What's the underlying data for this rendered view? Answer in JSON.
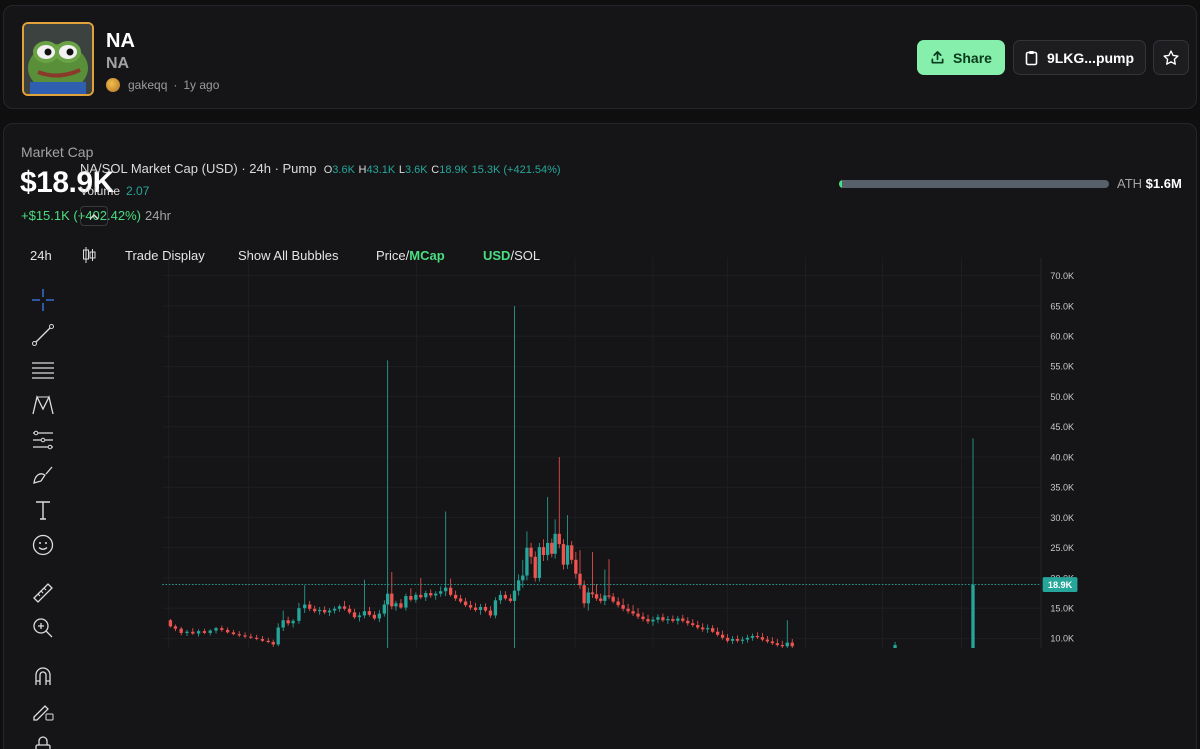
{
  "token": {
    "name": "NA",
    "symbol": "NA",
    "creator": "gakeqq",
    "age": "1y ago"
  },
  "actions": {
    "share_label": "Share",
    "contract_label": "9LKG...pump"
  },
  "market": {
    "label": "Market Cap",
    "value": "$18.9K",
    "change": "+$15.1K (+402.42%)",
    "period": "24hr",
    "ath_label": "ATH",
    "ath_value": "$1.6M",
    "ath_progress": 0.012
  },
  "toolbar": {
    "interval": "24h",
    "trade_display": "Trade Display",
    "show_bubbles": "Show All Bubbles",
    "price_label": "Price",
    "mcap_label": "MCap",
    "usd_label": "USD",
    "sol_label": "SOL"
  },
  "legend": {
    "title": "NA/SOL Market Cap (USD) · 24h · Pump",
    "o_key": "O",
    "o_val": "3.6K",
    "h_key": "H",
    "h_val": "43.1K",
    "l_key": "L",
    "l_val": "3.6K",
    "c_key": "C",
    "c_val": "18.9K",
    "change": "15.3K (+421.54%)",
    "volume_label": "Volume",
    "volume_value": "2.07"
  },
  "colors": {
    "up": "#26a69a",
    "down": "#ef5350",
    "accent": "#86efac"
  },
  "chart_data": {
    "type": "candlestick",
    "ylim": [
      8200,
      72000
    ],
    "yticks": [
      10000,
      15000,
      20000,
      25000,
      30000,
      35000,
      40000,
      45000,
      50000,
      55000,
      60000,
      65000,
      70000
    ],
    "ytick_labels": [
      "10.0K",
      "15.0K",
      "20.0K",
      "25.0K",
      "30.0K",
      "35.0K",
      "40.0K",
      "45.0K",
      "50.0K",
      "55.0K",
      "60.0K",
      "65.0K",
      "70.0K"
    ],
    "current_value": 18900,
    "current_label": "18.9K",
    "candles": [
      {
        "x": 76,
        "o": 13000,
        "h": 13200,
        "l": 11800,
        "c": 12000
      },
      {
        "x": 82,
        "o": 12000,
        "h": 12300,
        "l": 11200,
        "c": 11600
      },
      {
        "x": 89,
        "o": 11600,
        "h": 11900,
        "l": 10500,
        "c": 10900
      },
      {
        "x": 96,
        "o": 10900,
        "h": 11400,
        "l": 10400,
        "c": 11100
      },
      {
        "x": 103,
        "o": 11100,
        "h": 11700,
        "l": 10600,
        "c": 10800
      },
      {
        "x": 110,
        "o": 10800,
        "h": 11500,
        "l": 10300,
        "c": 11200
      },
      {
        "x": 117,
        "o": 11200,
        "h": 11600,
        "l": 10700,
        "c": 10900
      },
      {
        "x": 124,
        "o": 10900,
        "h": 11500,
        "l": 10500,
        "c": 11300
      },
      {
        "x": 131,
        "o": 11300,
        "h": 11900,
        "l": 10800,
        "c": 11700
      },
      {
        "x": 138,
        "o": 11700,
        "h": 12100,
        "l": 11100,
        "c": 11400
      },
      {
        "x": 145,
        "o": 11400,
        "h": 11800,
        "l": 10800,
        "c": 11000
      },
      {
        "x": 152,
        "o": 11000,
        "h": 11400,
        "l": 10500,
        "c": 10700
      },
      {
        "x": 159,
        "o": 10700,
        "h": 11200,
        "l": 10200,
        "c": 10500
      },
      {
        "x": 166,
        "o": 10500,
        "h": 11000,
        "l": 10000,
        "c": 10300
      },
      {
        "x": 173,
        "o": 10300,
        "h": 10800,
        "l": 9900,
        "c": 10100
      },
      {
        "x": 180,
        "o": 10100,
        "h": 10600,
        "l": 9700,
        "c": 9900
      },
      {
        "x": 187,
        "o": 9900,
        "h": 10400,
        "l": 9400,
        "c": 9600
      },
      {
        "x": 194,
        "o": 9600,
        "h": 10100,
        "l": 9200,
        "c": 9400
      },
      {
        "x": 200,
        "o": 9400,
        "h": 9800,
        "l": 8600,
        "c": 9000
      },
      {
        "x": 206,
        "o": 9000,
        "h": 12500,
        "l": 8700,
        "c": 11800
      },
      {
        "x": 212,
        "o": 11800,
        "h": 14600,
        "l": 11200,
        "c": 13000
      },
      {
        "x": 218,
        "o": 13000,
        "h": 13600,
        "l": 12100,
        "c": 12500
      },
      {
        "x": 224,
        "o": 12500,
        "h": 13200,
        "l": 11800,
        "c": 12900
      },
      {
        "x": 231,
        "o": 12900,
        "h": 15900,
        "l": 12400,
        "c": 15000
      },
      {
        "x": 238,
        "o": 15000,
        "h": 18800,
        "l": 14200,
        "c": 15600
      },
      {
        "x": 244,
        "o": 15600,
        "h": 16200,
        "l": 14500,
        "c": 14900
      },
      {
        "x": 250,
        "o": 14900,
        "h": 15400,
        "l": 14200,
        "c": 14500
      },
      {
        "x": 256,
        "o": 14500,
        "h": 15200,
        "l": 13900,
        "c": 14700
      },
      {
        "x": 262,
        "o": 14700,
        "h": 15300,
        "l": 14000,
        "c": 14300
      },
      {
        "x": 268,
        "o": 14300,
        "h": 15000,
        "l": 13700,
        "c": 14600
      },
      {
        "x": 274,
        "o": 14600,
        "h": 15300,
        "l": 14100,
        "c": 14900
      },
      {
        "x": 280,
        "o": 14900,
        "h": 15600,
        "l": 14400,
        "c": 15300
      },
      {
        "x": 286,
        "o": 15300,
        "h": 16200,
        "l": 14600,
        "c": 14900
      },
      {
        "x": 292,
        "o": 14900,
        "h": 15500,
        "l": 14000,
        "c": 14300
      },
      {
        "x": 298,
        "o": 14300,
        "h": 14900,
        "l": 13200,
        "c": 13500
      },
      {
        "x": 304,
        "o": 13500,
        "h": 14300,
        "l": 12800,
        "c": 13800
      },
      {
        "x": 310,
        "o": 13800,
        "h": 19700,
        "l": 13300,
        "c": 14500
      },
      {
        "x": 316,
        "o": 14500,
        "h": 15200,
        "l": 13600,
        "c": 13900
      },
      {
        "x": 322,
        "o": 13900,
        "h": 14500,
        "l": 13000,
        "c": 13300
      },
      {
        "x": 328,
        "o": 13300,
        "h": 14700,
        "l": 12700,
        "c": 14100
      },
      {
        "x": 334,
        "o": 14100,
        "h": 16300,
        "l": 13600,
        "c": 15600
      },
      {
        "x": 338,
        "o": 15600,
        "h": 56000,
        "l": 8200,
        "c": 17400
      },
      {
        "x": 343,
        "o": 17400,
        "h": 21000,
        "l": 14800,
        "c": 15300
      },
      {
        "x": 348,
        "o": 15300,
        "h": 16200,
        "l": 14600,
        "c": 15800
      },
      {
        "x": 354,
        "o": 15800,
        "h": 16500,
        "l": 14900,
        "c": 15100
      },
      {
        "x": 360,
        "o": 15100,
        "h": 17400,
        "l": 14600,
        "c": 17000
      },
      {
        "x": 366,
        "o": 17000,
        "h": 18300,
        "l": 16100,
        "c": 16400
      },
      {
        "x": 372,
        "o": 16400,
        "h": 17600,
        "l": 15900,
        "c": 17200
      },
      {
        "x": 378,
        "o": 17200,
        "h": 20000,
        "l": 16500,
        "c": 16800
      },
      {
        "x": 384,
        "o": 16800,
        "h": 17900,
        "l": 16200,
        "c": 17500
      },
      {
        "x": 390,
        "o": 17500,
        "h": 18100,
        "l": 16700,
        "c": 17100
      },
      {
        "x": 396,
        "o": 17100,
        "h": 17800,
        "l": 16400,
        "c": 17400
      },
      {
        "x": 402,
        "o": 17400,
        "h": 18600,
        "l": 16900,
        "c": 17800
      },
      {
        "x": 408,
        "o": 17800,
        "h": 31000,
        "l": 17000,
        "c": 18400
      },
      {
        "x": 414,
        "o": 18400,
        "h": 19900,
        "l": 16900,
        "c": 17200
      },
      {
        "x": 420,
        "o": 17200,
        "h": 17900,
        "l": 16200,
        "c": 16600
      },
      {
        "x": 426,
        "o": 16600,
        "h": 17200,
        "l": 15800,
        "c": 16100
      },
      {
        "x": 432,
        "o": 16100,
        "h": 16700,
        "l": 15200,
        "c": 15500
      },
      {
        "x": 438,
        "o": 15500,
        "h": 16200,
        "l": 14700,
        "c": 15100
      },
      {
        "x": 444,
        "o": 15100,
        "h": 15900,
        "l": 14400,
        "c": 14700
      },
      {
        "x": 450,
        "o": 14700,
        "h": 15700,
        "l": 13900,
        "c": 15200
      },
      {
        "x": 456,
        "o": 15200,
        "h": 15800,
        "l": 14300,
        "c": 14600
      },
      {
        "x": 462,
        "o": 14600,
        "h": 15300,
        "l": 13400,
        "c": 13800
      },
      {
        "x": 468,
        "o": 13800,
        "h": 16800,
        "l": 13300,
        "c": 16300
      },
      {
        "x": 474,
        "o": 16300,
        "h": 17900,
        "l": 15700,
        "c": 17200
      },
      {
        "x": 480,
        "o": 17200,
        "h": 17800,
        "l": 16300,
        "c": 16600
      },
      {
        "x": 486,
        "o": 16600,
        "h": 17300,
        "l": 15900,
        "c": 16200
      },
      {
        "x": 491,
        "o": 16200,
        "h": 65000,
        "l": 8200,
        "c": 17900
      },
      {
        "x": 496,
        "o": 17900,
        "h": 20600,
        "l": 17100,
        "c": 19600
      },
      {
        "x": 501,
        "o": 19600,
        "h": 23000,
        "l": 18400,
        "c": 20400
      },
      {
        "x": 506,
        "o": 20400,
        "h": 27700,
        "l": 19600,
        "c": 25000
      },
      {
        "x": 511,
        "o": 25000,
        "h": 25800,
        "l": 22300,
        "c": 23500
      },
      {
        "x": 516,
        "o": 23500,
        "h": 24400,
        "l": 19400,
        "c": 20000
      },
      {
        "x": 521,
        "o": 20000,
        "h": 25800,
        "l": 19400,
        "c": 25100
      },
      {
        "x": 526,
        "o": 25100,
        "h": 26400,
        "l": 22800,
        "c": 23800
      },
      {
        "x": 531,
        "o": 23800,
        "h": 33400,
        "l": 22900,
        "c": 25800
      },
      {
        "x": 536,
        "o": 25800,
        "h": 26500,
        "l": 23400,
        "c": 24000
      },
      {
        "x": 540,
        "o": 24000,
        "h": 29700,
        "l": 23200,
        "c": 27300
      },
      {
        "x": 545,
        "o": 27300,
        "h": 40000,
        "l": 24900,
        "c": 25600
      },
      {
        "x": 550,
        "o": 25600,
        "h": 26400,
        "l": 21400,
        "c": 22200
      },
      {
        "x": 555,
        "o": 22200,
        "h": 30400,
        "l": 21500,
        "c": 25400
      },
      {
        "x": 560,
        "o": 25400,
        "h": 26100,
        "l": 22300,
        "c": 23000
      },
      {
        "x": 565,
        "o": 23000,
        "h": 24300,
        "l": 19900,
        "c": 20700
      },
      {
        "x": 570,
        "o": 20700,
        "h": 24600,
        "l": 18200,
        "c": 18800
      },
      {
        "x": 575,
        "o": 18800,
        "h": 19600,
        "l": 15100,
        "c": 15800
      },
      {
        "x": 580,
        "o": 15800,
        "h": 18400,
        "l": 14600,
        "c": 17600
      },
      {
        "x": 585,
        "o": 17600,
        "h": 24300,
        "l": 16700,
        "c": 17300
      },
      {
        "x": 590,
        "o": 17300,
        "h": 19000,
        "l": 16200,
        "c": 16600
      },
      {
        "x": 595,
        "o": 16600,
        "h": 17400,
        "l": 15800,
        "c": 16200
      },
      {
        "x": 600,
        "o": 16200,
        "h": 21400,
        "l": 15500,
        "c": 17100
      },
      {
        "x": 605,
        "o": 17100,
        "h": 23100,
        "l": 16500,
        "c": 16900
      },
      {
        "x": 610,
        "o": 16900,
        "h": 17500,
        "l": 15800,
        "c": 16100
      },
      {
        "x": 616,
        "o": 16100,
        "h": 16800,
        "l": 15100,
        "c": 15500
      },
      {
        "x": 622,
        "o": 15500,
        "h": 16600,
        "l": 14500,
        "c": 14900
      },
      {
        "x": 628,
        "o": 14900,
        "h": 15700,
        "l": 14100,
        "c": 14500
      },
      {
        "x": 634,
        "o": 14500,
        "h": 15500,
        "l": 13700,
        "c": 14100
      },
      {
        "x": 640,
        "o": 14100,
        "h": 15000,
        "l": 13200,
        "c": 13600
      },
      {
        "x": 646,
        "o": 13600,
        "h": 14300,
        "l": 12800,
        "c": 13200
      },
      {
        "x": 652,
        "o": 13200,
        "h": 13900,
        "l": 12400,
        "c": 12800
      },
      {
        "x": 658,
        "o": 12800,
        "h": 13600,
        "l": 12100,
        "c": 13100
      },
      {
        "x": 664,
        "o": 13100,
        "h": 14000,
        "l": 12500,
        "c": 13500
      },
      {
        "x": 670,
        "o": 13500,
        "h": 14100,
        "l": 12700,
        "c": 13000
      },
      {
        "x": 676,
        "o": 13000,
        "h": 13700,
        "l": 12400,
        "c": 13200
      },
      {
        "x": 682,
        "o": 13200,
        "h": 13800,
        "l": 12600,
        "c": 12900
      },
      {
        "x": 688,
        "o": 12900,
        "h": 13700,
        "l": 12300,
        "c": 13300
      },
      {
        "x": 694,
        "o": 13300,
        "h": 13900,
        "l": 12600,
        "c": 12900
      },
      {
        "x": 700,
        "o": 12900,
        "h": 13500,
        "l": 12100,
        "c": 12500
      },
      {
        "x": 706,
        "o": 12500,
        "h": 13200,
        "l": 11900,
        "c": 12200
      },
      {
        "x": 712,
        "o": 12200,
        "h": 12900,
        "l": 11500,
        "c": 11800
      },
      {
        "x": 718,
        "o": 11800,
        "h": 12500,
        "l": 11100,
        "c": 11500
      },
      {
        "x": 724,
        "o": 11500,
        "h": 12300,
        "l": 10900,
        "c": 11700
      },
      {
        "x": 730,
        "o": 11700,
        "h": 12200,
        "l": 10900,
        "c": 11100
      },
      {
        "x": 736,
        "o": 11100,
        "h": 11800,
        "l": 10300,
        "c": 10600
      },
      {
        "x": 742,
        "o": 10600,
        "h": 11300,
        "l": 9800,
        "c": 10100
      },
      {
        "x": 748,
        "o": 10100,
        "h": 10700,
        "l": 9300,
        "c": 9600
      },
      {
        "x": 754,
        "o": 9600,
        "h": 10400,
        "l": 9100,
        "c": 9900
      },
      {
        "x": 760,
        "o": 9900,
        "h": 10500,
        "l": 9300,
        "c": 9600
      },
      {
        "x": 766,
        "o": 9600,
        "h": 10300,
        "l": 9100,
        "c": 9800
      },
      {
        "x": 772,
        "o": 9800,
        "h": 10600,
        "l": 9300,
        "c": 10100
      },
      {
        "x": 778,
        "o": 10100,
        "h": 10800,
        "l": 9600,
        "c": 10400
      },
      {
        "x": 784,
        "o": 10400,
        "h": 11000,
        "l": 9900,
        "c": 10200
      },
      {
        "x": 790,
        "o": 10200,
        "h": 10900,
        "l": 9500,
        "c": 9800
      },
      {
        "x": 796,
        "o": 9800,
        "h": 10400,
        "l": 9200,
        "c": 9500
      },
      {
        "x": 802,
        "o": 9500,
        "h": 10200,
        "l": 8900,
        "c": 9200
      },
      {
        "x": 808,
        "o": 9200,
        "h": 9900,
        "l": 8600,
        "c": 8900
      },
      {
        "x": 814,
        "o": 8900,
        "h": 9600,
        "l": 8300,
        "c": 8700
      },
      {
        "x": 820,
        "o": 8700,
        "h": 13000,
        "l": 8300,
        "c": 9300
      },
      {
        "x": 826,
        "o": 9300,
        "h": 9900,
        "l": 8400,
        "c": 8700
      },
      {
        "x": 950,
        "o": 8400,
        "h": 9400,
        "l": 8200,
        "c": 8900
      },
      {
        "x": 1044,
        "o": 8300,
        "h": 43100,
        "l": 8200,
        "c": 18900
      }
    ]
  }
}
